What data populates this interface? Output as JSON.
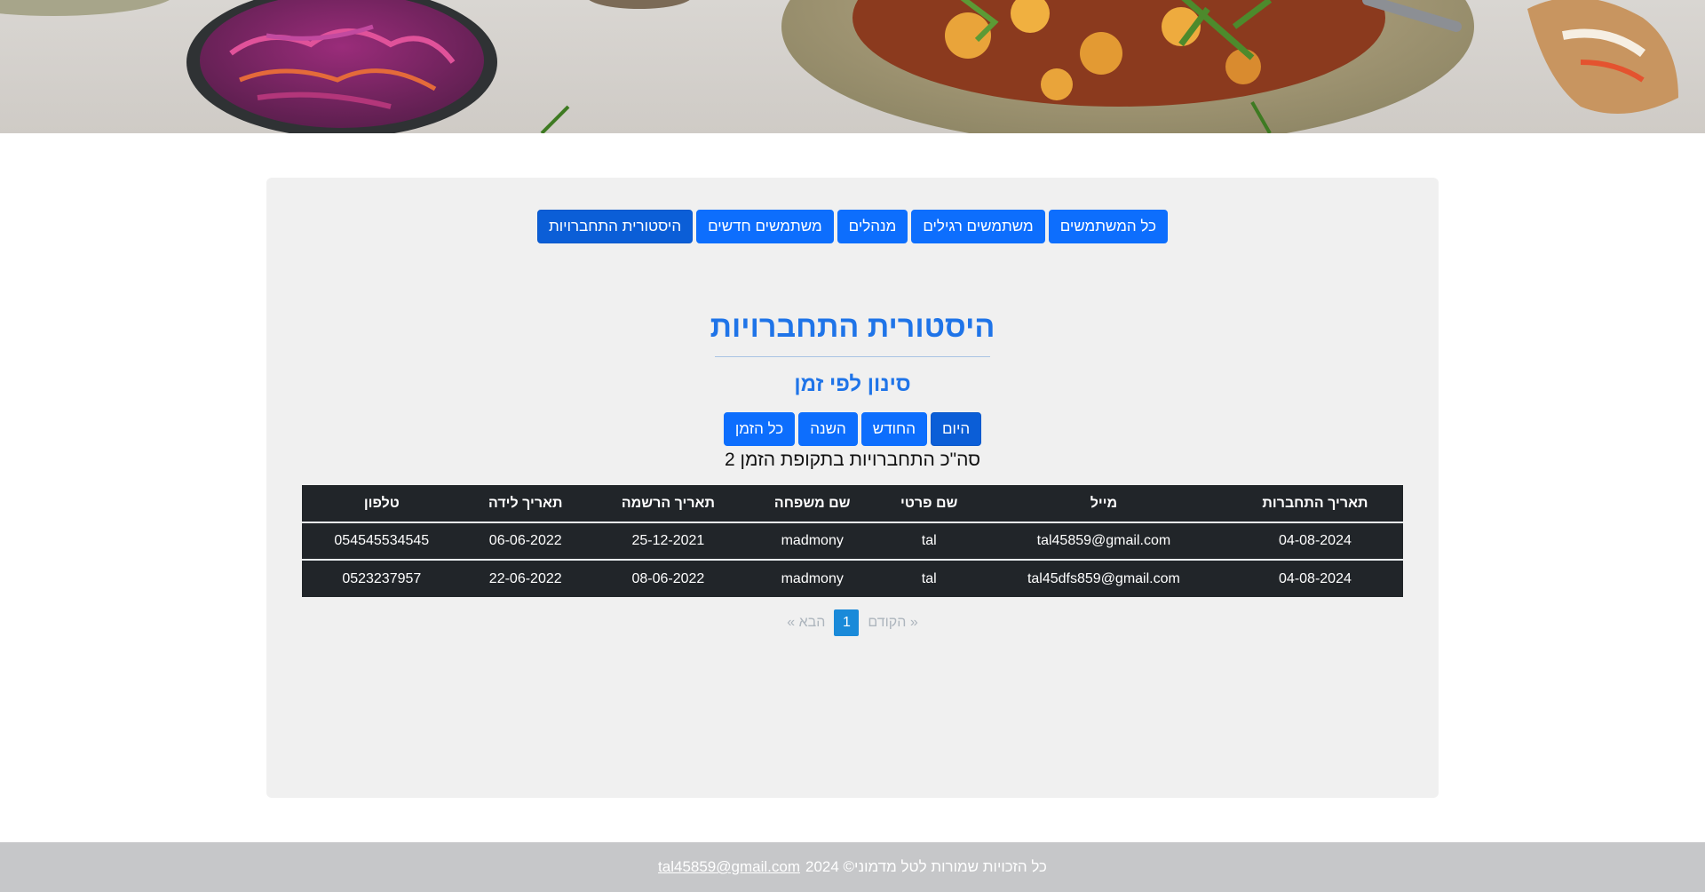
{
  "nav": {
    "buttons": [
      {
        "label": "כל המשתמשים"
      },
      {
        "label": "משתמשים רגילים"
      },
      {
        "label": "מנהלים"
      },
      {
        "label": "משתמשים חדשים"
      },
      {
        "label": "היסטורית התחברויות"
      }
    ]
  },
  "page": {
    "title": "היסטורית התחברויות",
    "filter_title": "סינון לפי זמן",
    "total_label": "סה\"כ התחברויות בתקופת הזמן 2"
  },
  "filters": {
    "buttons": [
      {
        "label": "היום"
      },
      {
        "label": "החודש"
      },
      {
        "label": "השנה"
      },
      {
        "label": "כל הזמן"
      }
    ]
  },
  "table": {
    "headers": [
      "תאריך התחברות",
      "מייל",
      "שם פרטי",
      "שם משפחה",
      "תאריך הרשמה",
      "תאריך לידה",
      "טלפון"
    ],
    "rows": [
      [
        "04-08-2024",
        "tal45859@gmail.com",
        "tal",
        "madmony",
        "25-12-2021",
        "06-06-2022",
        "054545534545"
      ],
      [
        "04-08-2024",
        "tal45dfs859@gmail.com",
        "tal",
        "madmony",
        "08-06-2022",
        "22-06-2022",
        "0523237957"
      ]
    ]
  },
  "pagination": {
    "prev": "« הקודם",
    "current": "1",
    "next": "הבא »"
  },
  "footer": {
    "text": "כל הזכויות שמורות לטל מדמוני© 2024",
    "email": "tal45859@gmail.com"
  },
  "colors": {
    "primary": "#0d6efd",
    "title": "#1f74e8",
    "table_bg": "#212529",
    "panel_bg": "#f0f0f0",
    "footer_bg": "#c6c7c9"
  }
}
